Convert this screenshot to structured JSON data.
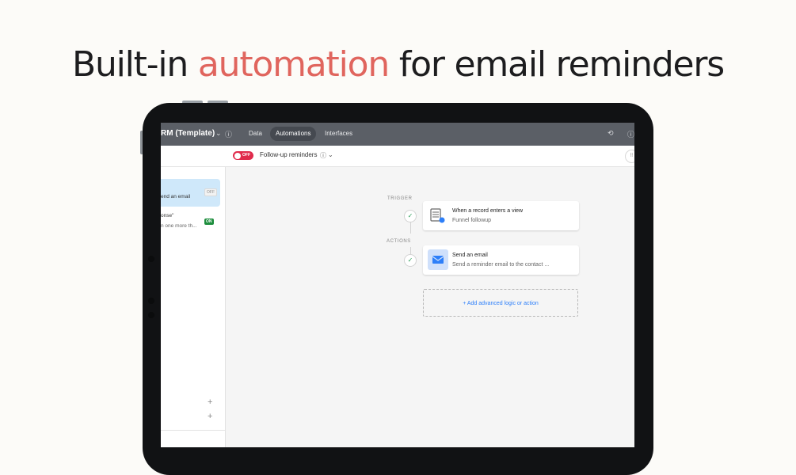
{
  "headline": {
    "part1": "Built-in ",
    "accent": "automation",
    "part2": " for email reminders"
  },
  "colors": {
    "accent": "#e0655e",
    "topbar": "#5b5f66",
    "toggle_off": "#e02b4c",
    "on_badge": "#1e8e3e",
    "link_blue": "#2d7ff9"
  },
  "topbar": {
    "base_name": "RM (Template)",
    "tabs": [
      {
        "label": "Data",
        "active": false
      },
      {
        "label": "Automations",
        "active": true
      },
      {
        "label": "Interfaces",
        "active": false
      }
    ],
    "icons": [
      "chevron-down-icon",
      "info-icon",
      "history-icon",
      "help-icon"
    ]
  },
  "subbar": {
    "toggle_label": "OFF",
    "automation_name": "Follow-up reminders",
    "icons": [
      "info-icon",
      "chevron-down-icon",
      "grid-icon"
    ]
  },
  "sidebar": {
    "items": [
      {
        "line1": "",
        "line2": "end an email",
        "status": "OFF",
        "selected": true
      },
      {
        "line1": "onse\"",
        "line2": "n one more th...",
        "status": "ON",
        "selected": false
      }
    ],
    "plus_buttons": [
      "+",
      "+"
    ]
  },
  "canvas": {
    "trigger_label": "TRIGGER",
    "actions_label": "ACTIONS",
    "trigger": {
      "title": "When a record enters a view",
      "subtitle": "Funnel followup",
      "icon": "table-view-icon"
    },
    "action": {
      "title": "Send an email",
      "subtitle": "Send a reminder email to the contact ...",
      "icon": "envelope-icon"
    },
    "add_label": "+ Add advanced logic or action"
  }
}
